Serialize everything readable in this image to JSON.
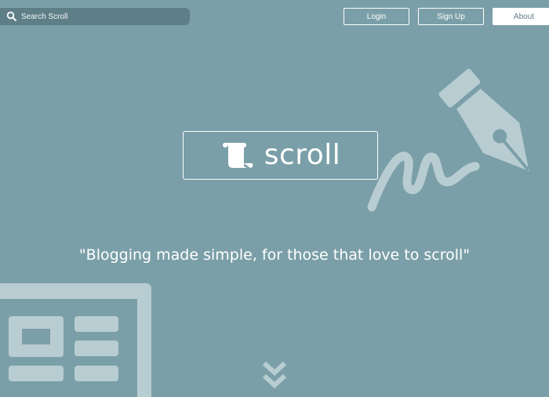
{
  "search": {
    "placeholder": "Search Scroll",
    "icon": "search-icon"
  },
  "nav": {
    "login_label": "Login",
    "signup_label": "Sign Up",
    "about_label": "About"
  },
  "brand": {
    "name": "scroll",
    "icon": "scroll-icon"
  },
  "hero": {
    "tagline": "\"Blogging made simple, for those that love to scroll\""
  },
  "scroll_indicator": {
    "icon": "double-chevron-down-icon"
  },
  "colors": {
    "background": "#7b9fa8",
    "search_bg": "#5f7f88",
    "decoration": "#b8cdd2",
    "text": "#ffffff"
  }
}
